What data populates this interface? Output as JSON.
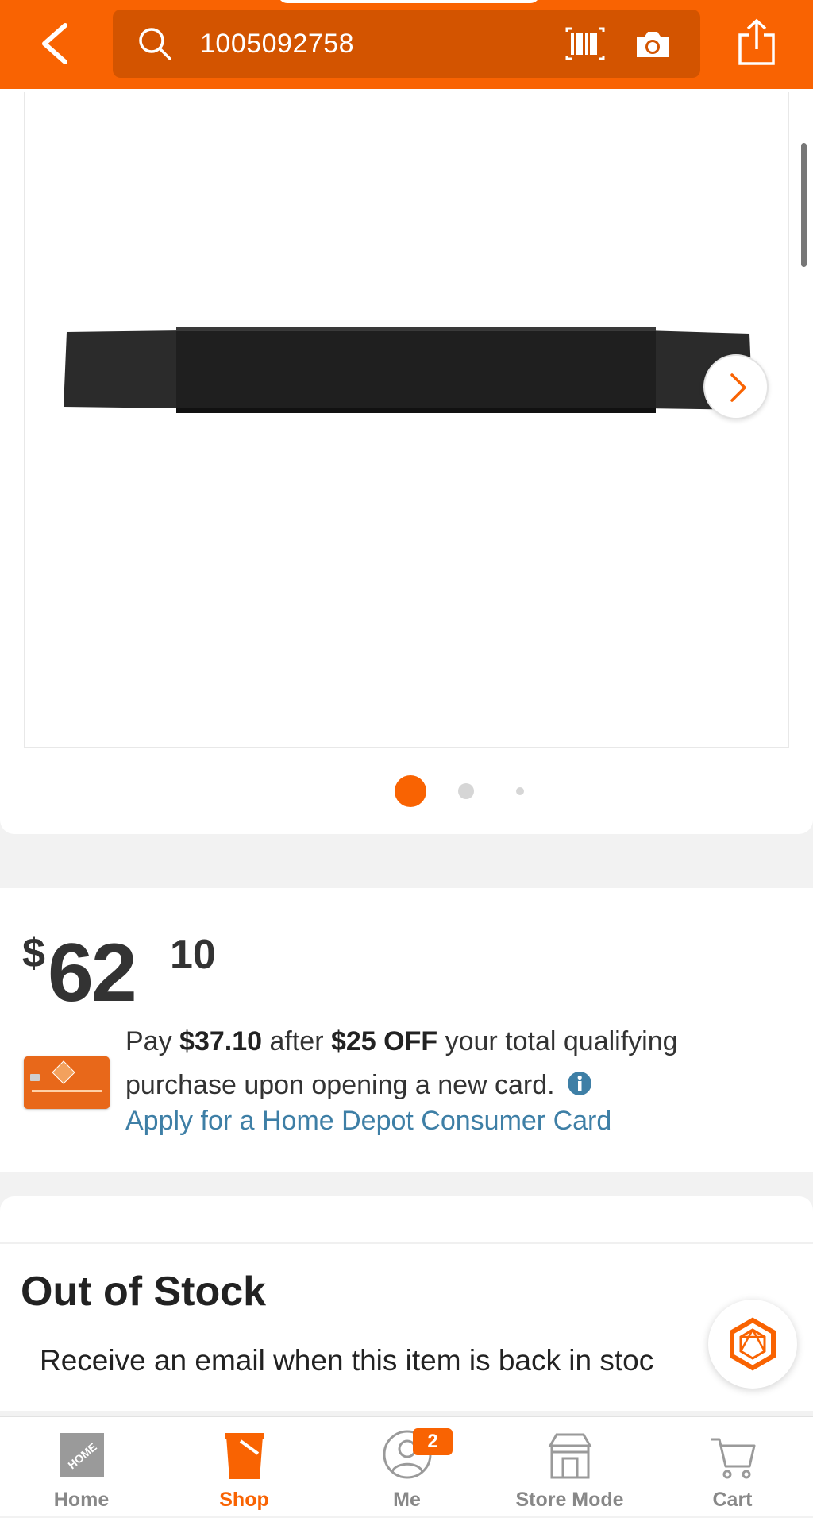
{
  "header": {
    "search_query": "1005092758",
    "icons": [
      "back-arrow-icon",
      "search-icon",
      "barcode-icon",
      "camera-icon",
      "share-icon"
    ],
    "background_color": "#f96302"
  },
  "gallery": {
    "image_count": 3,
    "active_index": 0,
    "accent_color": "#f96302"
  },
  "price": {
    "currency": "$",
    "dollars": "62",
    "cents": "10"
  },
  "promo": {
    "text_pay": "Pay ",
    "amount_after": "$37.10",
    "text_after": " after ",
    "discount": "$25 OFF",
    "text_rest": " your total qualifying purchase upon opening a new card.",
    "apply_link": "Apply for a Home Depot Consumer Card",
    "link_color": "#3e7fa6"
  },
  "stock": {
    "title": "Out of Stock",
    "description": "Receive an email when this item is back in stoc"
  },
  "bottom_nav": {
    "items": [
      {
        "label": "Home",
        "icon": "home-depot-logo-icon",
        "active": false
      },
      {
        "label": "Shop",
        "icon": "shop-bucket-icon",
        "active": true
      },
      {
        "label": "Me",
        "icon": "user-icon",
        "active": false,
        "badge": "2"
      },
      {
        "label": "Store Mode",
        "icon": "store-icon",
        "active": false
      },
      {
        "label": "Cart",
        "icon": "cart-icon",
        "active": false
      }
    ]
  }
}
